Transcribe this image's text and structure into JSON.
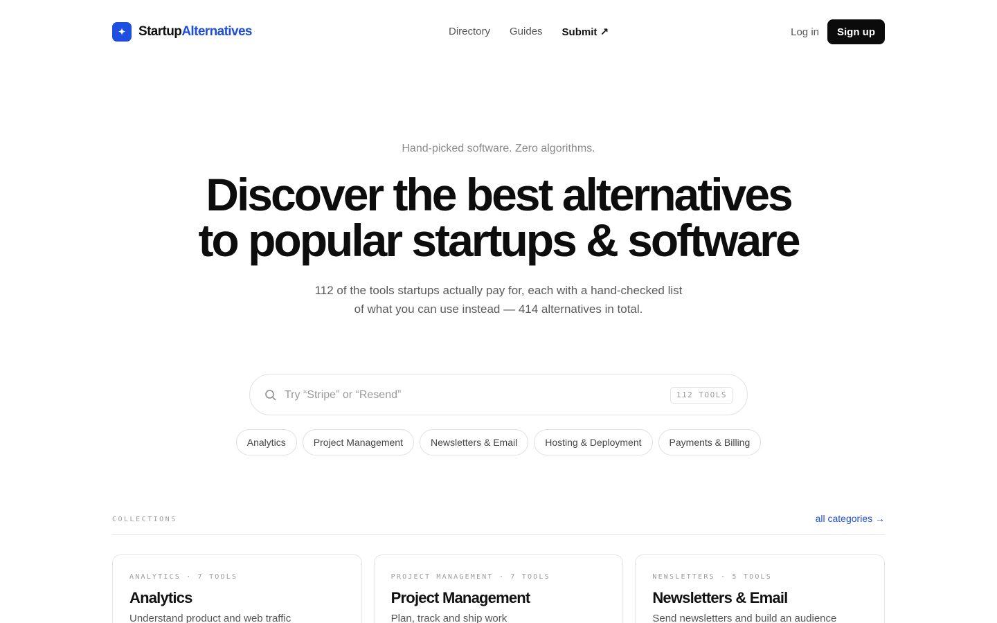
{
  "nav": {
    "brand_prefix": "Startup",
    "brand_accent": "Alternatives",
    "brand_icon": "sparkle-icon",
    "links": [
      "Directory",
      "Guides",
      "Submit ↗"
    ],
    "login": "Log in",
    "signup": "Sign up"
  },
  "hero": {
    "eyebrow": "Hand-picked software. Zero algorithms.",
    "headline_line1": "Discover the best alternatives",
    "headline_line2": "to popular startups & software",
    "sub_line1": "112 of the tools startups actually pay for, each with a hand-checked list",
    "sub_line2": "of what you can use instead — 414 alternatives in total."
  },
  "search": {
    "placeholder": "Try “Stripe” or “Resend”",
    "value": "",
    "count_badge": "112 TOOLS"
  },
  "chips": [
    "Analytics",
    "Project Management",
    "Newsletters & Email",
    "Hosting & Deployment",
    "Payments & Billing"
  ],
  "collections": {
    "label": "COLLECTIONS",
    "link": "all categories →",
    "cards": [
      {
        "meta": "ANALYTICS · 7 TOOLS",
        "title": "Analytics",
        "desc": "Understand product and web traffic"
      },
      {
        "meta": "PROJECT MANAGEMENT · 7 TOOLS",
        "title": "Project Management",
        "desc": "Plan, track and ship work"
      },
      {
        "meta": "NEWSLETTERS · 5 TOOLS",
        "title": "Newsletters & Email",
        "desc": "Send newsletters and build an audience"
      }
    ]
  },
  "colors": {
    "accent": "#1f4fd8",
    "button_dark": "#0b0b0b"
  }
}
